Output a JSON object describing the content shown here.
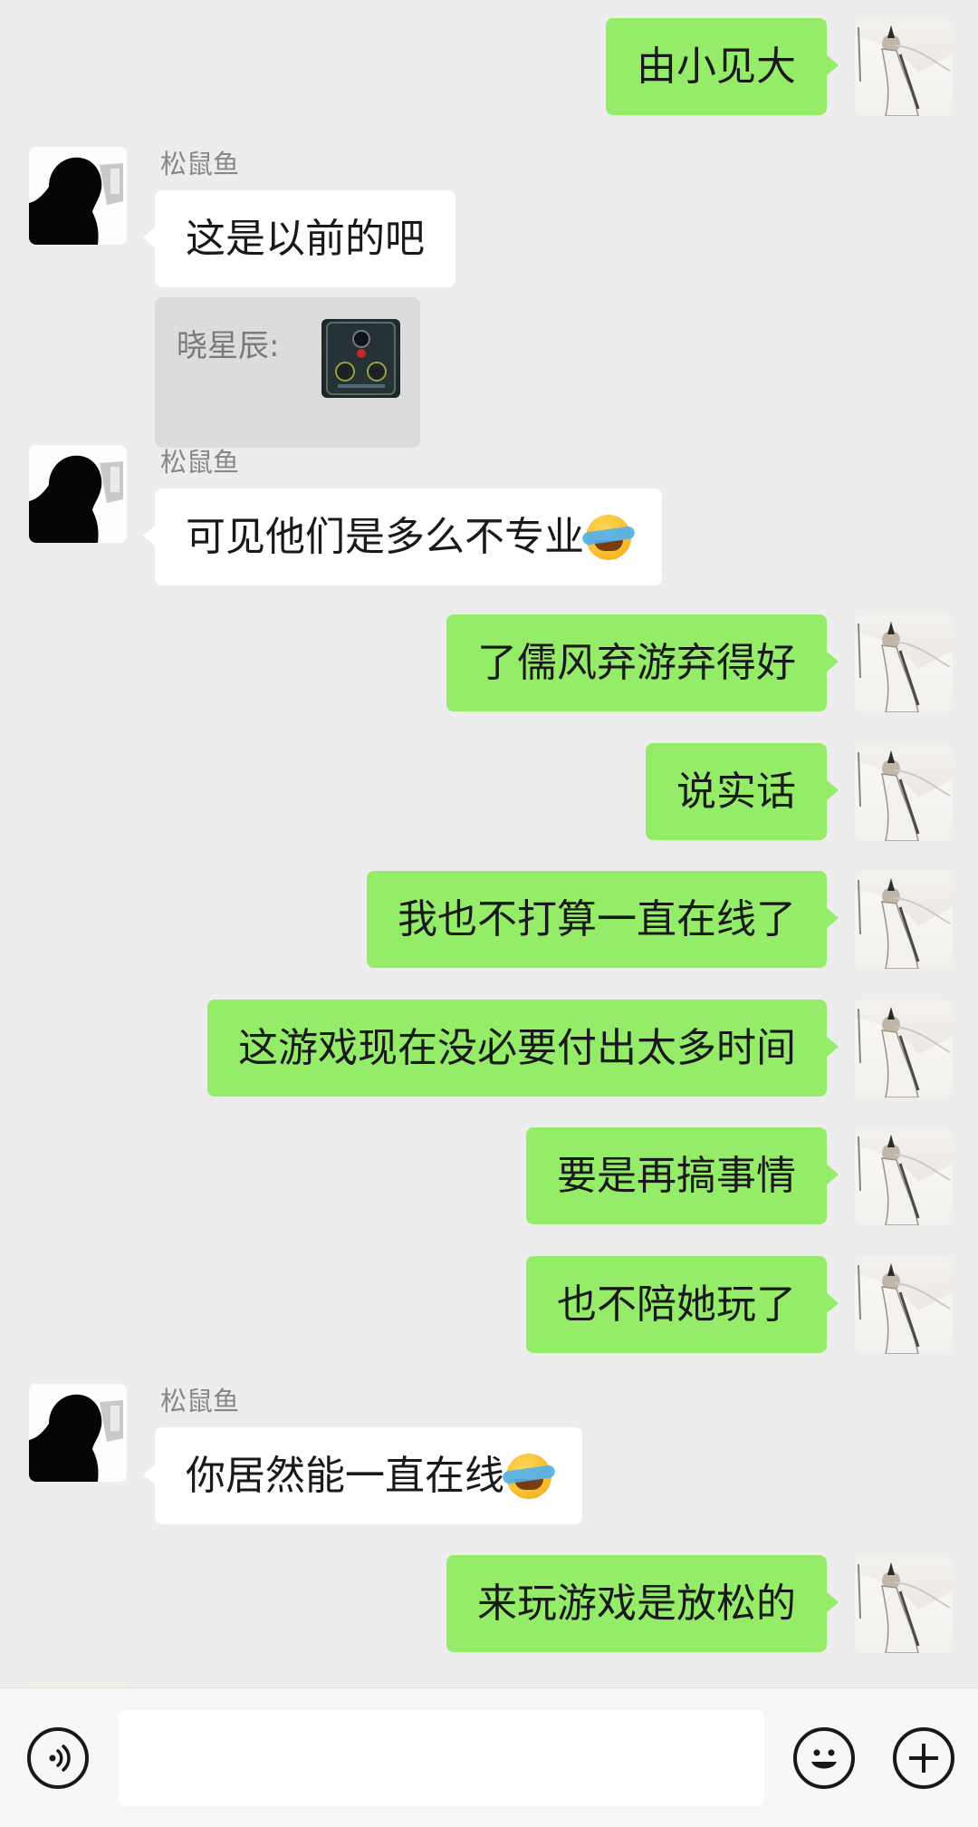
{
  "contacts": {
    "other_name": "松鼠鱼",
    "me_avatar_icon": "character-avatar",
    "other_avatar_icon": "silhouette-avatar"
  },
  "messages": [
    {
      "id": "m1",
      "from": "me",
      "text": "由小见大"
    },
    {
      "id": "m2",
      "from": "other",
      "sender": "松鼠鱼",
      "text": "这是以前的吧"
    },
    {
      "id": "m3",
      "from": "other",
      "quote_label": "晓星辰:",
      "quote_icon": "image-thumbnail"
    },
    {
      "id": "m4",
      "from": "other",
      "sender": "松鼠鱼",
      "text": "可见他们是多么不专业",
      "emoji": "face-with-tears-emoji"
    },
    {
      "id": "m5",
      "from": "me",
      "text": "了儒风弃游弃得好"
    },
    {
      "id": "m6",
      "from": "me",
      "text": "说实话"
    },
    {
      "id": "m7",
      "from": "me",
      "text": "我也不打算一直在线了"
    },
    {
      "id": "m8",
      "from": "me",
      "text": "这游戏现在没必要付出太多时间"
    },
    {
      "id": "m9",
      "from": "me",
      "text": "要是再搞事情"
    },
    {
      "id": "m10",
      "from": "me",
      "text": "也不陪她玩了"
    },
    {
      "id": "m11",
      "from": "other",
      "sender": "松鼠鱼",
      "text": "你居然能一直在线",
      "emoji": "face-with-tears-emoji"
    },
    {
      "id": "m12",
      "from": "me",
      "text": "来玩游戏是放松的"
    }
  ],
  "input_bar": {
    "voice_icon": "voice-icon",
    "emoji_icon": "smiley-icon",
    "add_icon": "plus-icon",
    "text_value": ""
  },
  "colors": {
    "background": "#ededed",
    "bubble_me": "#95ec69",
    "bubble_other": "#ffffff",
    "sender_name": "#888888"
  }
}
